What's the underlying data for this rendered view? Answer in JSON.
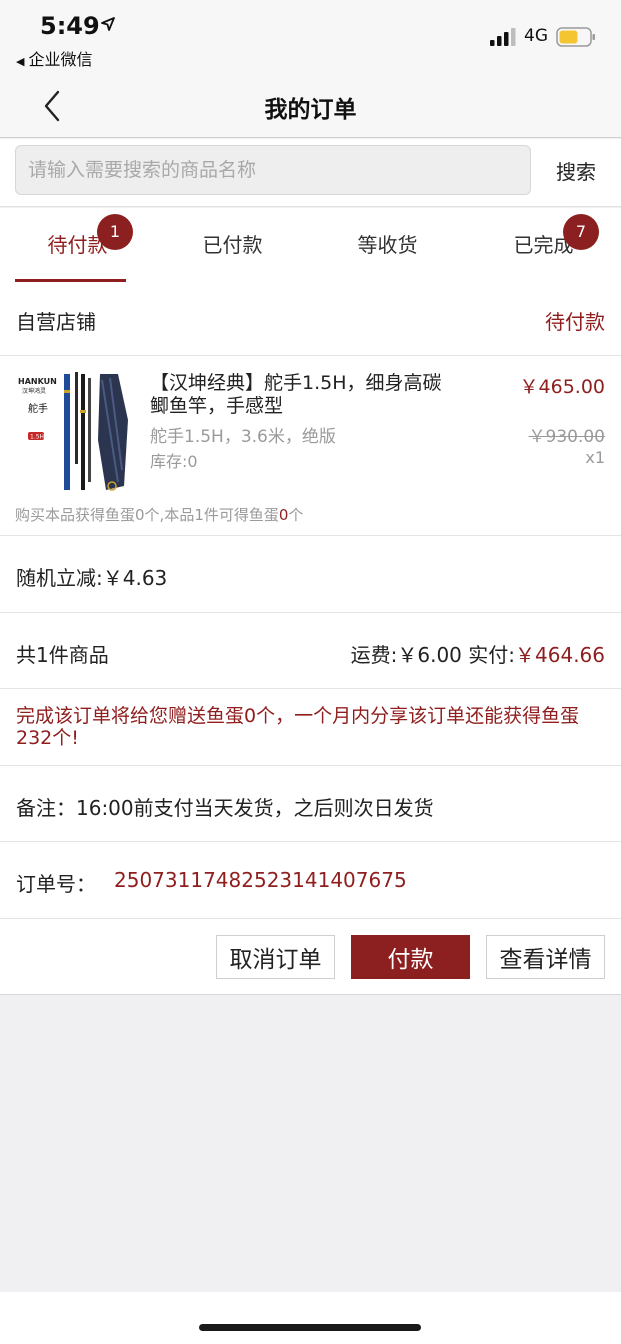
{
  "status_bar": {
    "time": "5:49",
    "back_app": "企业微信",
    "network": "4G",
    "battery_color": "#f5c431"
  },
  "nav": {
    "title": "我的订单",
    "back_icon": "chevron-left-icon"
  },
  "search": {
    "placeholder": "请输入需要搜索的商品名称",
    "value": "",
    "button_label": "搜索"
  },
  "tabs": [
    {
      "label": "待付款",
      "badge": "1",
      "active": true
    },
    {
      "label": "已付款",
      "badge": "",
      "active": false
    },
    {
      "label": "等收货",
      "badge": "",
      "active": false
    },
    {
      "label": "已完成",
      "badge": "7",
      "active": false
    }
  ],
  "order": {
    "shop_name": "自营店铺",
    "status": "待付款",
    "product": {
      "thumb_brand": "HANKUN",
      "thumb_brand_cn": "汉坤鸿灵",
      "thumb_model": "舵手",
      "thumb_tag": "1.5H",
      "title": "【汉坤经典】舵手1.5H，细身高碳鲫鱼竿，手感型",
      "spec": "舵手1.5H，3.6米，绝版",
      "stock": "库存:0",
      "price": "￥465.00",
      "original_price": "￥930.00",
      "quantity": "x1",
      "reward_prefix": "购买本品获得鱼蛋0个,本品1件可得鱼蛋",
      "reward_count": "0",
      "reward_suffix": "个"
    },
    "discount": "随机立减:￥4.63",
    "total_count": "共1件商品",
    "shipping_label": "运费:",
    "shipping_value": "￥6.00",
    "paid_label": "实付:",
    "paid_value": "￥464.66",
    "notice": "完成该订单将给您赠送鱼蛋0个，一个月内分享该订单还能获得鱼蛋232个!",
    "remark": "备注：16:00前支付当天发货，之后则次日发货",
    "order_no_label": "订单号：",
    "order_no": "250731174825231414 07675"
  },
  "actions": {
    "cancel": "取消订单",
    "pay": "付款",
    "detail": "查看详情"
  },
  "colors": {
    "accent": "#8f1e1e",
    "badge": "#8c1f1f",
    "muted": "#9a9a9a"
  }
}
